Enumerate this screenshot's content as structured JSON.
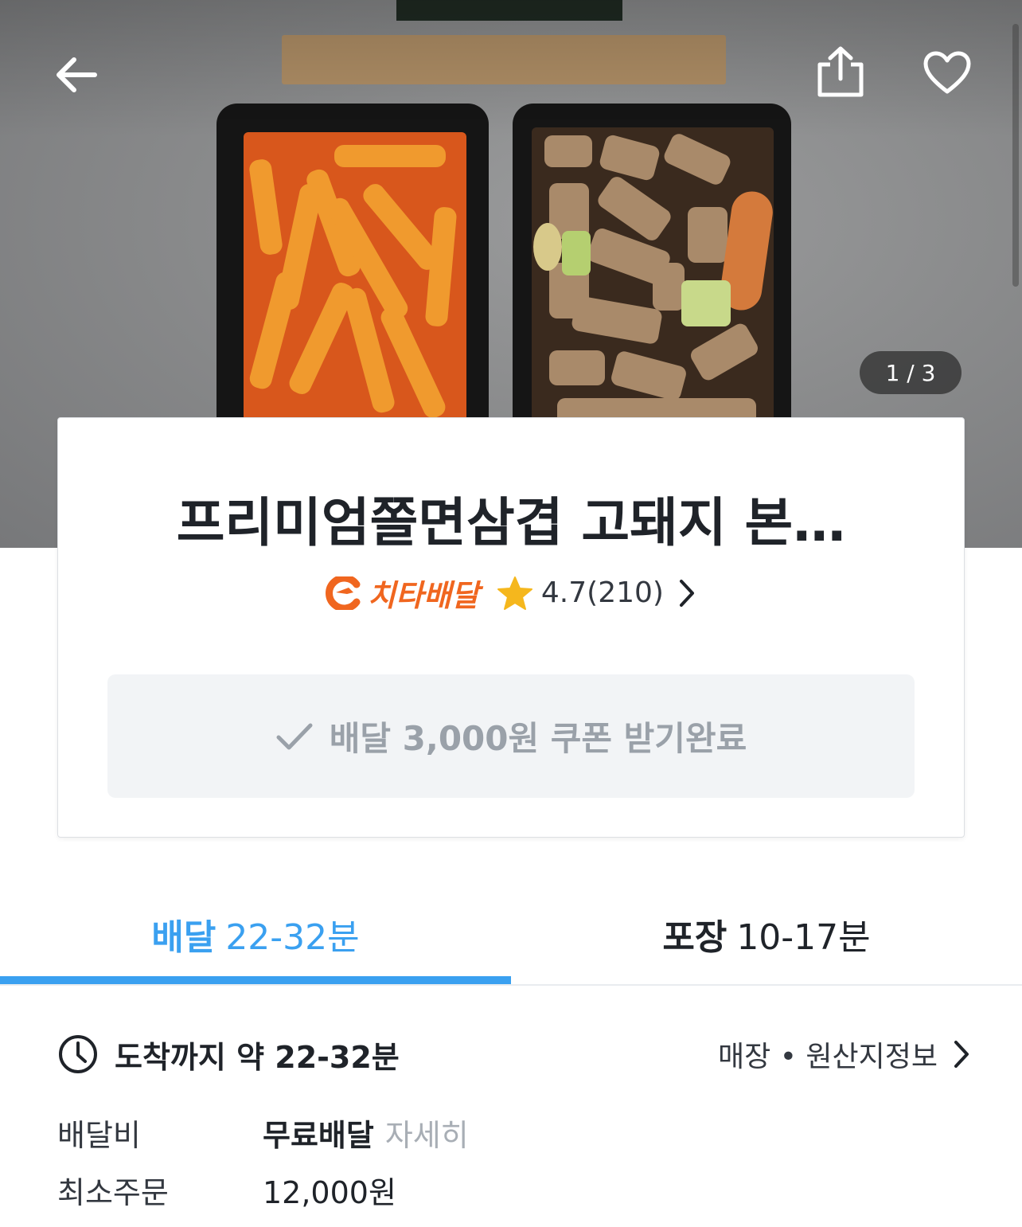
{
  "hero": {
    "image_counter": "1 / 3",
    "icons": {
      "back": "back-arrow-icon",
      "share": "share-icon",
      "favorite": "heart-icon"
    }
  },
  "store": {
    "name": "프리미엄쫄면삼겹 고돼지 본…",
    "brand": "치타배달",
    "rating": "4.7(210)",
    "coupon_text": "배달 3,000원 쿠폰 받기완료"
  },
  "tabs": [
    {
      "label": "배달",
      "time": "22-32분"
    },
    {
      "label": "포장",
      "time": "10-17분"
    }
  ],
  "info": {
    "eta_label": "도착까지 약 22-32분",
    "store_info_link": "매장 • 원산지정보",
    "delivery_fee_label": "배달비",
    "delivery_fee_value": "무료배달",
    "delivery_fee_detail": "자세히",
    "min_order_label": "최소주문",
    "min_order_value": "12,000원"
  },
  "colors": {
    "accent_blue": "#3aa0f0",
    "brand_orange": "#f0661f",
    "star_yellow": "#f5b71d",
    "coupon_bg": "#f2f4f6",
    "muted_text": "#9aa1a9"
  }
}
